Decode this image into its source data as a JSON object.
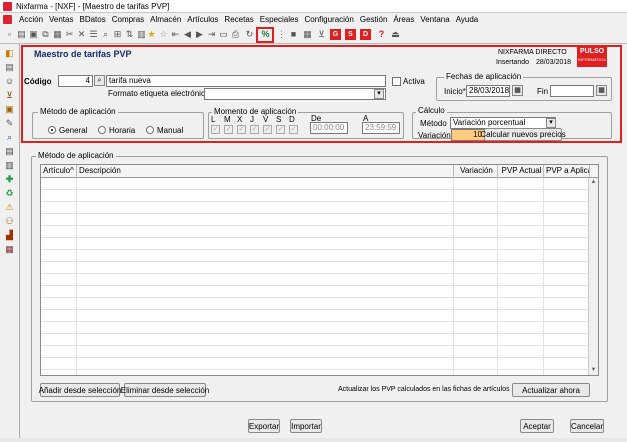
{
  "window": {
    "title": "Nixfarma - [NXF] - [Maestro de tarifas PVP]"
  },
  "menu": [
    "Acción",
    "Ventas",
    "BDatos",
    "Compras",
    "Almacén",
    "Artículos",
    "Recetas",
    "Especiales",
    "Configuración",
    "Gestión",
    "Áreas",
    "Ventana",
    "Ayuda"
  ],
  "form": {
    "title": "Maestro de tarifas PVP",
    "company": "NIXFARMA DIRECTO",
    "mode": "Insertando",
    "date": "28/03/2018",
    "logo": {
      "text": "PULSO",
      "sub": "INFORMÁTICA"
    },
    "codigo": {
      "label": "Código",
      "value": "4",
      "name": "tarifa nueva"
    },
    "activa_label": "Activa",
    "formato_label": "Formato etiqueta electrónica",
    "formato_value": "",
    "fechas": {
      "title": "Fechas de aplicación",
      "inicio_label": "Inicio*",
      "inicio_value": "28/03/2018",
      "fin_label": "Fin",
      "fin_value": ""
    },
    "metodo": {
      "title": "Método de aplicación",
      "options": [
        "General",
        "Horaria",
        "Manual"
      ],
      "selected": "General"
    },
    "momento": {
      "title": "Momento de aplicación",
      "days": [
        "L",
        "M",
        "X",
        "J",
        "V",
        "S",
        "D"
      ],
      "de_label": "De",
      "de_value": "00:00:00",
      "a_label": "A",
      "a_value": "23:59:59"
    },
    "calculo": {
      "title": "Cálculo",
      "metodo_label": "Método",
      "metodo_value": "Variación porcentual",
      "variacion_label": "Variación",
      "variacion_value": "10",
      "calc_button": "Calcular nuevos precios"
    }
  },
  "table": {
    "group_title": "Método de aplicación",
    "columns": [
      "Artículo^",
      "Descripción",
      "Variación",
      "PVP Actual",
      "PVP a Aplicar"
    ],
    "rows": []
  },
  "actions": {
    "add": "Añadir desde selección",
    "remove": "Eliminar desde selección",
    "actualizar_text": "Actualizar los PVP calculados en las fichas de artículos",
    "actualizar_button": "Actualizar ahora"
  },
  "footer": {
    "exportar": "Exportar",
    "importar": "Importar",
    "aceptar": "Aceptar",
    "cancelar": "Cancelar"
  },
  "colors": {
    "highlight": "#e02020",
    "variacion_bg": "#ffcc80",
    "brand": "#e02020"
  }
}
